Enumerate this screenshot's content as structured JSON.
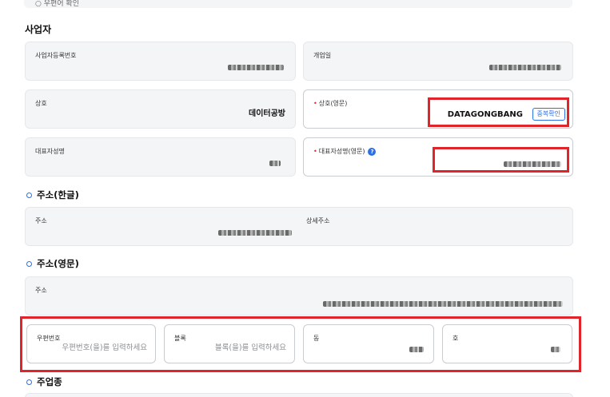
{
  "top_strip": {
    "text": "○ 우편어 확인"
  },
  "business": {
    "title": "사업자",
    "reg_number_label": "사업자등록번호",
    "open_date_label": "개업일",
    "trade_name_label": "상호",
    "trade_name_value": "데이터공방",
    "trade_name_en_label": "상호(영문)",
    "trade_name_en_value": "DATAGONGBANG",
    "duplicate_check_label": "중복확인",
    "ceo_name_label": "대표자성명",
    "ceo_name_en_label": "대표자성명(영문)",
    "help_icon": "?"
  },
  "address_kr": {
    "title": "주소(한글)",
    "address_label": "주소",
    "detail_label": "상세주소"
  },
  "address_en": {
    "title": "주소(영문)",
    "address_label": "주소",
    "zipcode_label": "우편번호",
    "zipcode_placeholder": "우편번호(을)를 입력하세요",
    "block_label": "블록",
    "block_placeholder": "블록(을)를 입력하세요",
    "dong_label": "동",
    "ho_label": "호"
  },
  "industry": {
    "title": "주업종"
  },
  "colors": {
    "accent": "#2f6fe4",
    "highlight": "#e0242a",
    "readonly_bg": "#f4f5f7"
  }
}
